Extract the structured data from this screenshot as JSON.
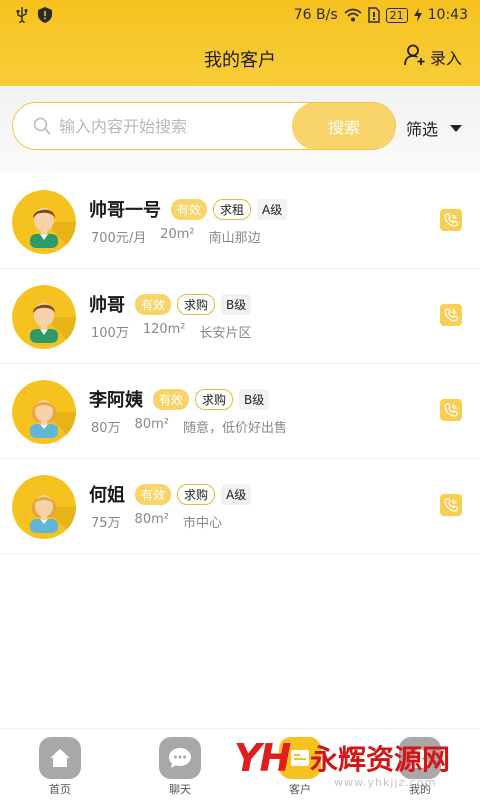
{
  "status_bar": {
    "speed": "76 B/s",
    "battery": "21",
    "time": "10:43",
    "icons": [
      "usb-icon",
      "shield-icon",
      "wifi-icon",
      "sim-icon",
      "battery-icon",
      "charging-icon"
    ]
  },
  "header": {
    "title": "我的客户",
    "action_label": "录入",
    "action_icon": "add-user-icon"
  },
  "search": {
    "placeholder": "输入内容开始搜索",
    "value": "",
    "button_label": "搜索",
    "filter_label": "筛选"
  },
  "customers": [
    {
      "name": "帅哥一号",
      "status": "有效",
      "type": "求租",
      "level": "A级",
      "budget": "700元/月",
      "area": "20m²",
      "location": "南山那边",
      "gender": "male"
    },
    {
      "name": "帅哥",
      "status": "有效",
      "type": "求购",
      "level": "B级",
      "budget": "100万",
      "area": "120m²",
      "location": "长安片区",
      "gender": "male"
    },
    {
      "name": "李阿姨",
      "status": "有效",
      "type": "求购",
      "level": "B级",
      "budget": "80万",
      "area": "80m²",
      "location": "随意，低价好出售",
      "gender": "female"
    },
    {
      "name": "何姐",
      "status": "有效",
      "type": "求购",
      "level": "A级",
      "budget": "75万",
      "area": "80m²",
      "location": "市中心",
      "gender": "female"
    }
  ],
  "bottom_nav": {
    "items": [
      {
        "label": "首页",
        "icon": "home-icon"
      },
      {
        "label": "聊天",
        "icon": "chat-icon"
      },
      {
        "label": "客户",
        "icon": "customers-icon"
      },
      {
        "label": "我的",
        "icon": "profile-icon"
      }
    ]
  },
  "watermark": {
    "text": "永辉资源网",
    "url": "www.yhkjjz.com"
  },
  "colors": {
    "brand_yellow": "#f6c21f",
    "button_yellow": "#f8d46a",
    "tag_border": "#e8b93b"
  }
}
